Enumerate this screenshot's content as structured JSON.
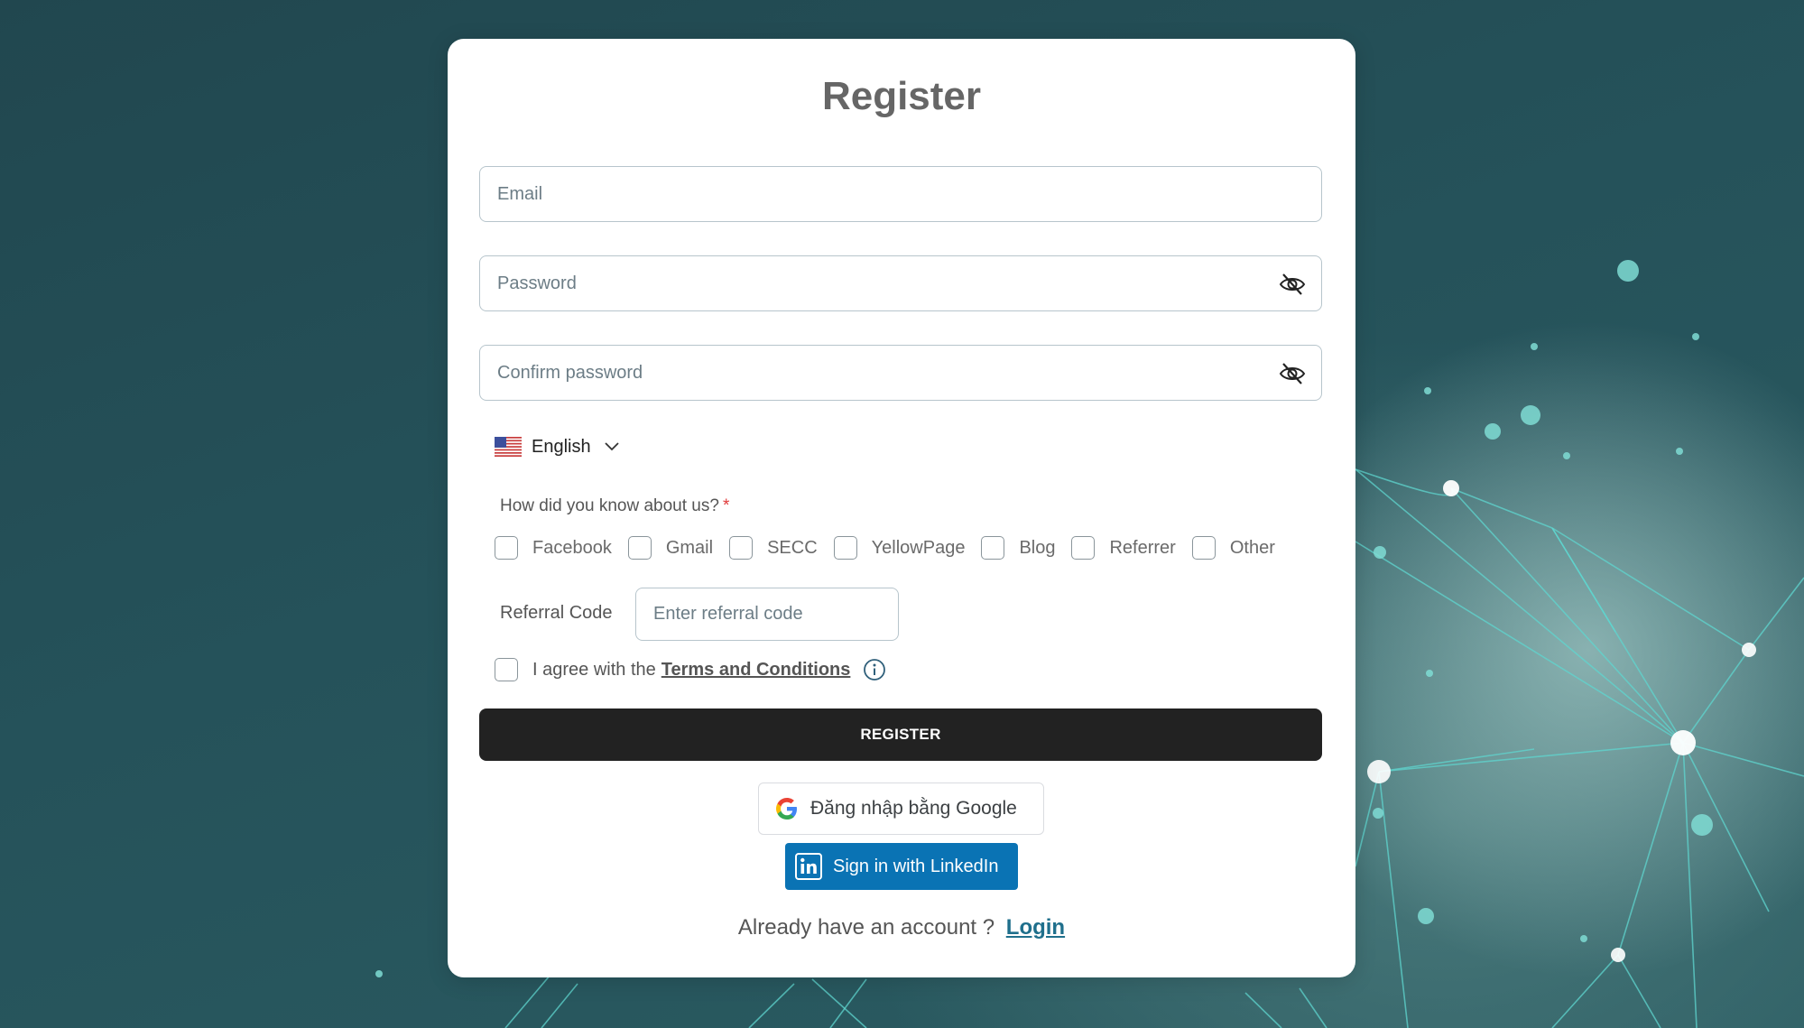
{
  "page": {
    "title": "Register"
  },
  "form": {
    "email": {
      "placeholder": "Email",
      "value": ""
    },
    "password": {
      "placeholder": "Password",
      "value": ""
    },
    "confirm_password": {
      "placeholder": "Confirm password",
      "value": ""
    },
    "language": {
      "selected": "English",
      "flag": "us-flag-icon"
    },
    "source_question": "How did you know about us?",
    "required_mark": "*",
    "sources": [
      {
        "label": "Facebook",
        "checked": false
      },
      {
        "label": "Gmail",
        "checked": false
      },
      {
        "label": "SECC",
        "checked": false
      },
      {
        "label": "YellowPage",
        "checked": false
      },
      {
        "label": "Blog",
        "checked": false
      },
      {
        "label": "Referrer",
        "checked": false
      },
      {
        "label": "Other",
        "checked": false
      }
    ],
    "referral": {
      "label": "Referral Code",
      "placeholder": "Enter referral code",
      "value": ""
    },
    "agree": {
      "text": "I agree with the",
      "link": "Terms and Conditions",
      "checked": false
    },
    "register_label": "REGISTER"
  },
  "social": {
    "google_label": "Đăng nhập bằng Google",
    "linkedin_label": "Sign in with LinkedIn"
  },
  "footer": {
    "prompt": "Already have an account ?",
    "login_label": "Login"
  },
  "colors": {
    "background": "#25525a",
    "card": "#ffffff",
    "register_button": "#222222",
    "linkedin": "#0a73b4",
    "login_link": "#1f6f8c",
    "required": "#e03b3b"
  },
  "icons": {
    "password_toggle": "eye-off-icon",
    "confirm_toggle": "eye-off-icon",
    "language_chevron": "chevron-down-icon",
    "terms_info": "info-icon",
    "google": "google-logo-icon",
    "linkedin": "linkedin-logo-icon"
  }
}
